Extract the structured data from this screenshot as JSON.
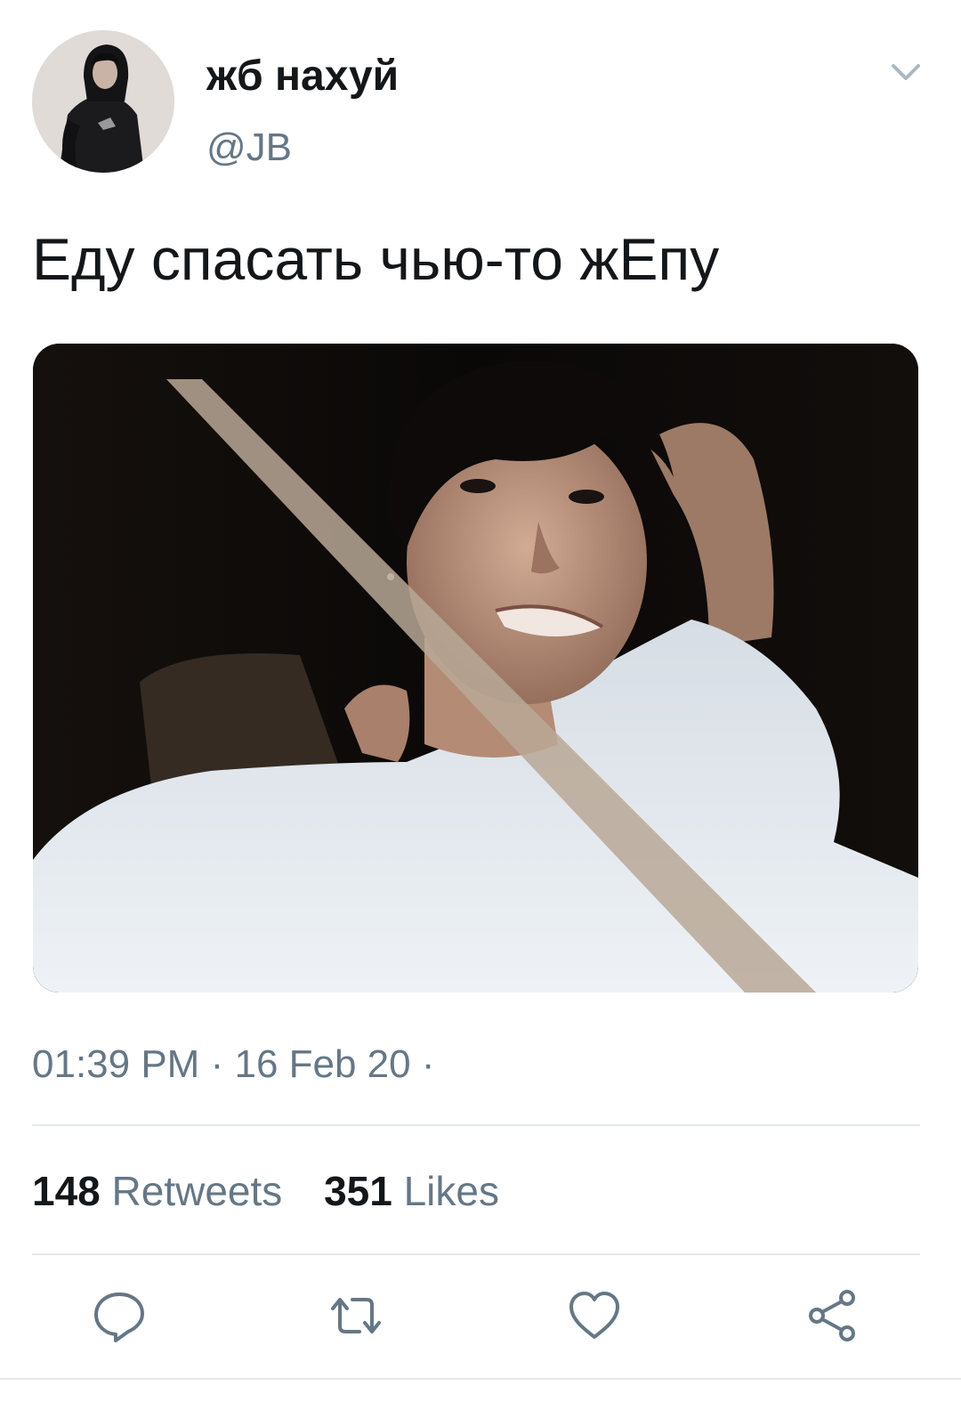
{
  "tweet": {
    "author": {
      "display_name": "жб нахуй",
      "handle": "@JB"
    },
    "text": "Еду спасать чью-то жЕпу",
    "time": "01:39 PM",
    "date": "16 Feb 20",
    "separator": "·",
    "stats": {
      "retweets_count": "148",
      "retweets_label": "Retweets",
      "likes_count": "351",
      "likes_label": "Likes"
    },
    "icons": {
      "menu": "chevron-down-icon",
      "reply": "reply-icon",
      "retweet": "retweet-icon",
      "like": "heart-icon",
      "share": "share-icon"
    }
  },
  "colors": {
    "primary_text": "#14171a",
    "secondary_text": "#657786",
    "divider": "#e1e8ed"
  }
}
